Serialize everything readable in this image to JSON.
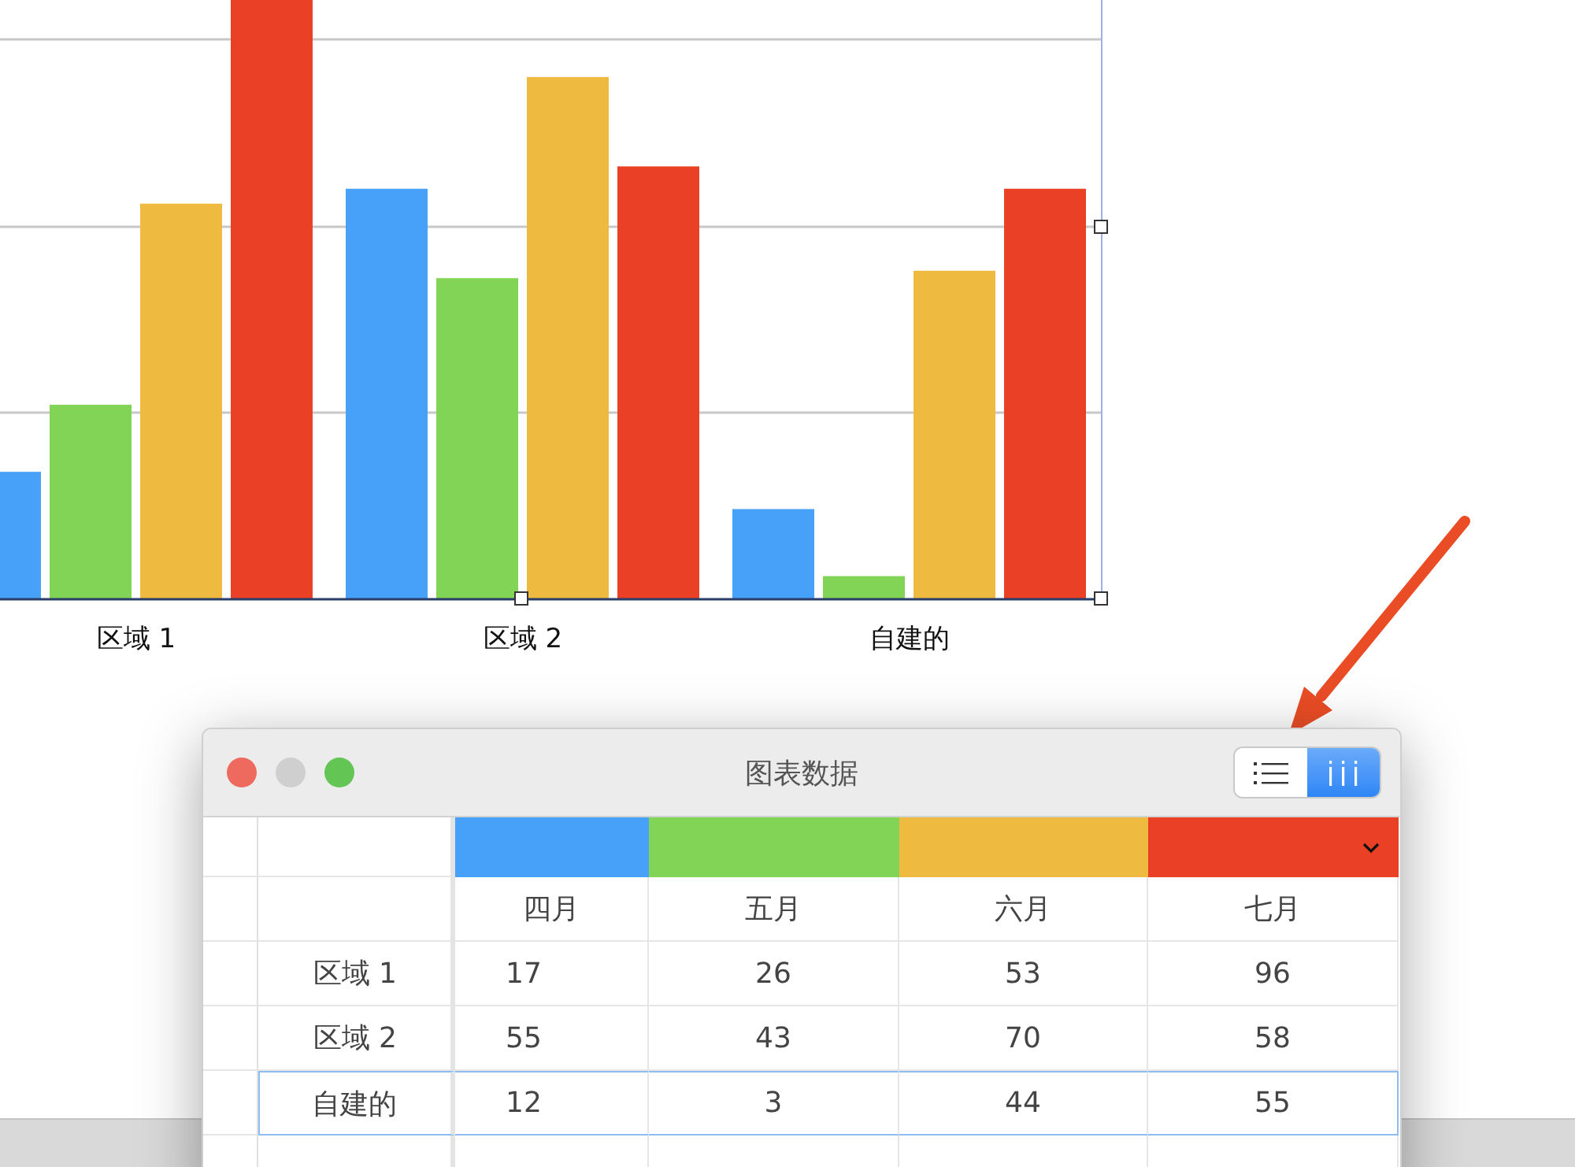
{
  "chart": {
    "category_labels": [
      "区域 1",
      "区域 2",
      "自建的"
    ]
  },
  "window": {
    "title": "图表数据"
  },
  "view_toggle": [
    {
      "kind": "list",
      "selected": false
    },
    {
      "kind": "columns",
      "selected": true
    }
  ],
  "table": {
    "series": [
      {
        "name": "四月",
        "color": "#48a1f8",
        "menu": false
      },
      {
        "name": "五月",
        "color": "#82d456",
        "menu": false
      },
      {
        "name": "六月",
        "color": "#eeba40",
        "menu": false
      },
      {
        "name": "七月",
        "color": "#e94026",
        "menu": true
      }
    ],
    "rows": [
      {
        "label": "区域 1",
        "values": [
          "17",
          "26",
          "53",
          "96"
        ],
        "selected": false
      },
      {
        "label": "区域 2",
        "values": [
          "55",
          "43",
          "70",
          "58"
        ],
        "selected": false
      },
      {
        "label": "自建的",
        "values": [
          "12",
          "3",
          "44",
          "55"
        ],
        "selected": true
      }
    ]
  }
}
